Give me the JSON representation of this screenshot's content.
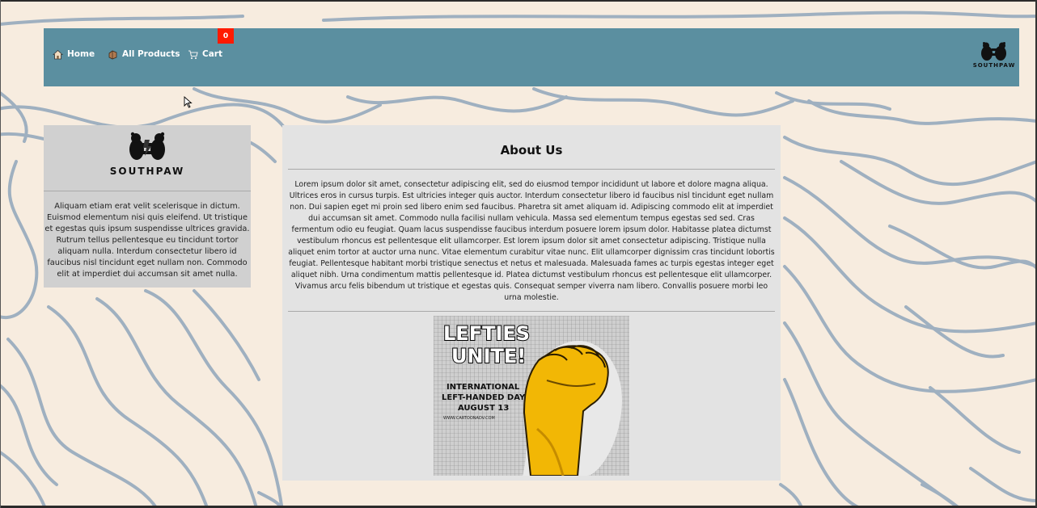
{
  "navbar": {
    "items": [
      {
        "label": "Home",
        "icon": "home-icon"
      },
      {
        "label": "All Products",
        "icon": "products-icon"
      },
      {
        "label": "Cart",
        "icon": "cart-icon"
      }
    ],
    "cart_count": "0",
    "brand": "SOUTHPAW",
    "colors": {
      "bar": "#5b8fa0",
      "badge": "#ff1a00"
    }
  },
  "sidebar": {
    "brand": "SOUTHPAW",
    "text": "Aliquam etiam erat velit scelerisque in dictum. Euismod elementum nisi quis eleifend. Ut tristique et egestas quis ipsum suspendisse ultrices gravida. Rutrum tellus pellentesque eu tincidunt tortor aliquam nulla. Interdum consectetur libero id faucibus nisl tincidunt eget nullam non. Commodo elit at imperdiet dui accumsan sit amet nulla."
  },
  "about": {
    "title": "About Us",
    "text": "Lorem ipsum dolor sit amet, consectetur adipiscing elit, sed do eiusmod tempor incididunt ut labore et dolore magna aliqua. Ultrices eros in cursus turpis. Est ultricies integer quis auctor. Interdum consectetur libero id faucibus nisl tincidunt eget nullam non. Dui sapien eget mi proin sed libero enim sed faucibus. Pharetra sit amet aliquam id. Adipiscing commodo elit at imperdiet dui accumsan sit amet. Commodo nulla facilisi nullam vehicula. Massa sed elementum tempus egestas sed sed. Cras fermentum odio eu feugiat. Quam lacus suspendisse faucibus interdum posuere lorem ipsum dolor. Habitasse platea dictumst vestibulum rhoncus est pellentesque elit ullamcorper. Est lorem ipsum dolor sit amet consectetur adipiscing. Tristique nulla aliquet enim tortor at auctor urna nunc. Vitae elementum curabitur vitae nunc. Elit ullamcorper dignissim cras tincidunt lobortis feugiat. Pellentesque habitant morbi tristique senectus et netus et malesuada. Malesuada fames ac turpis egestas integer eget aliquet nibh. Urna condimentum mattis pellentesque id. Platea dictumst vestibulum rhoncus est pellentesque elit ullamcorper. Vivamus arcu felis bibendum ut tristique et egestas quis. Consequat semper viverra nam libero. Convallis posuere morbi leo urna molestie.",
    "poster": {
      "headline_1": "LEFTIES",
      "headline_2": "UNITE!",
      "line_1": "INTERNATIONAL",
      "line_2": "LEFT-HANDED DAY",
      "line_3": "AUGUST 13",
      "credit": "WWW.CARTOONADV.COM"
    }
  }
}
